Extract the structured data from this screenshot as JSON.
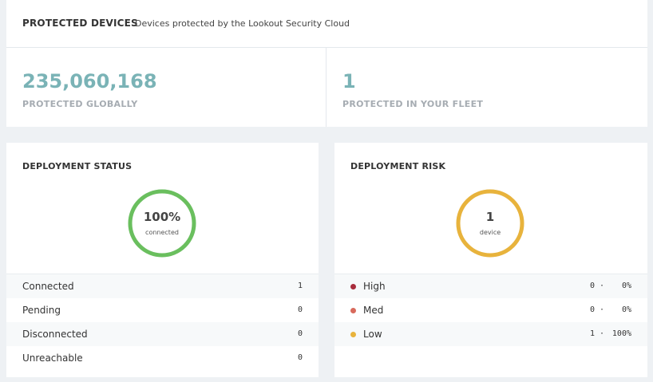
{
  "protected_devices": {
    "title": "PROTECTED DEVICES",
    "subtitle": "Devices protected by the Lookout Security Cloud",
    "global": {
      "value": "235,060,168",
      "label": "PROTECTED GLOBALLY"
    },
    "fleet": {
      "value": "1",
      "label": "PROTECTED IN YOUR FLEET"
    },
    "accent_color": "#7ab3b6"
  },
  "deployment_status": {
    "title": "DEPLOYMENT STATUS",
    "ring": {
      "main": "100%",
      "sub": "connected",
      "fraction": 1.0,
      "color": "#6abf5e"
    },
    "rows": [
      {
        "label": "Connected",
        "value": "1"
      },
      {
        "label": "Pending",
        "value": "0"
      },
      {
        "label": "Disconnected",
        "value": "0"
      },
      {
        "label": "Unreachable",
        "value": "0"
      }
    ]
  },
  "deployment_risk": {
    "title": "DEPLOYMENT RISK",
    "ring": {
      "main": "1",
      "sub": "device",
      "fraction": 1.0,
      "color": "#e8b33c"
    },
    "rows": [
      {
        "label": "High",
        "count": "0",
        "sep": "·",
        "percent": "0%",
        "color": "#a82c3c"
      },
      {
        "label": "Med",
        "count": "0",
        "sep": "·",
        "percent": "0%",
        "color": "#d86a5c"
      },
      {
        "label": "Low",
        "count": "1",
        "sep": "·",
        "percent": "100%",
        "color": "#e8b33c"
      }
    ]
  }
}
